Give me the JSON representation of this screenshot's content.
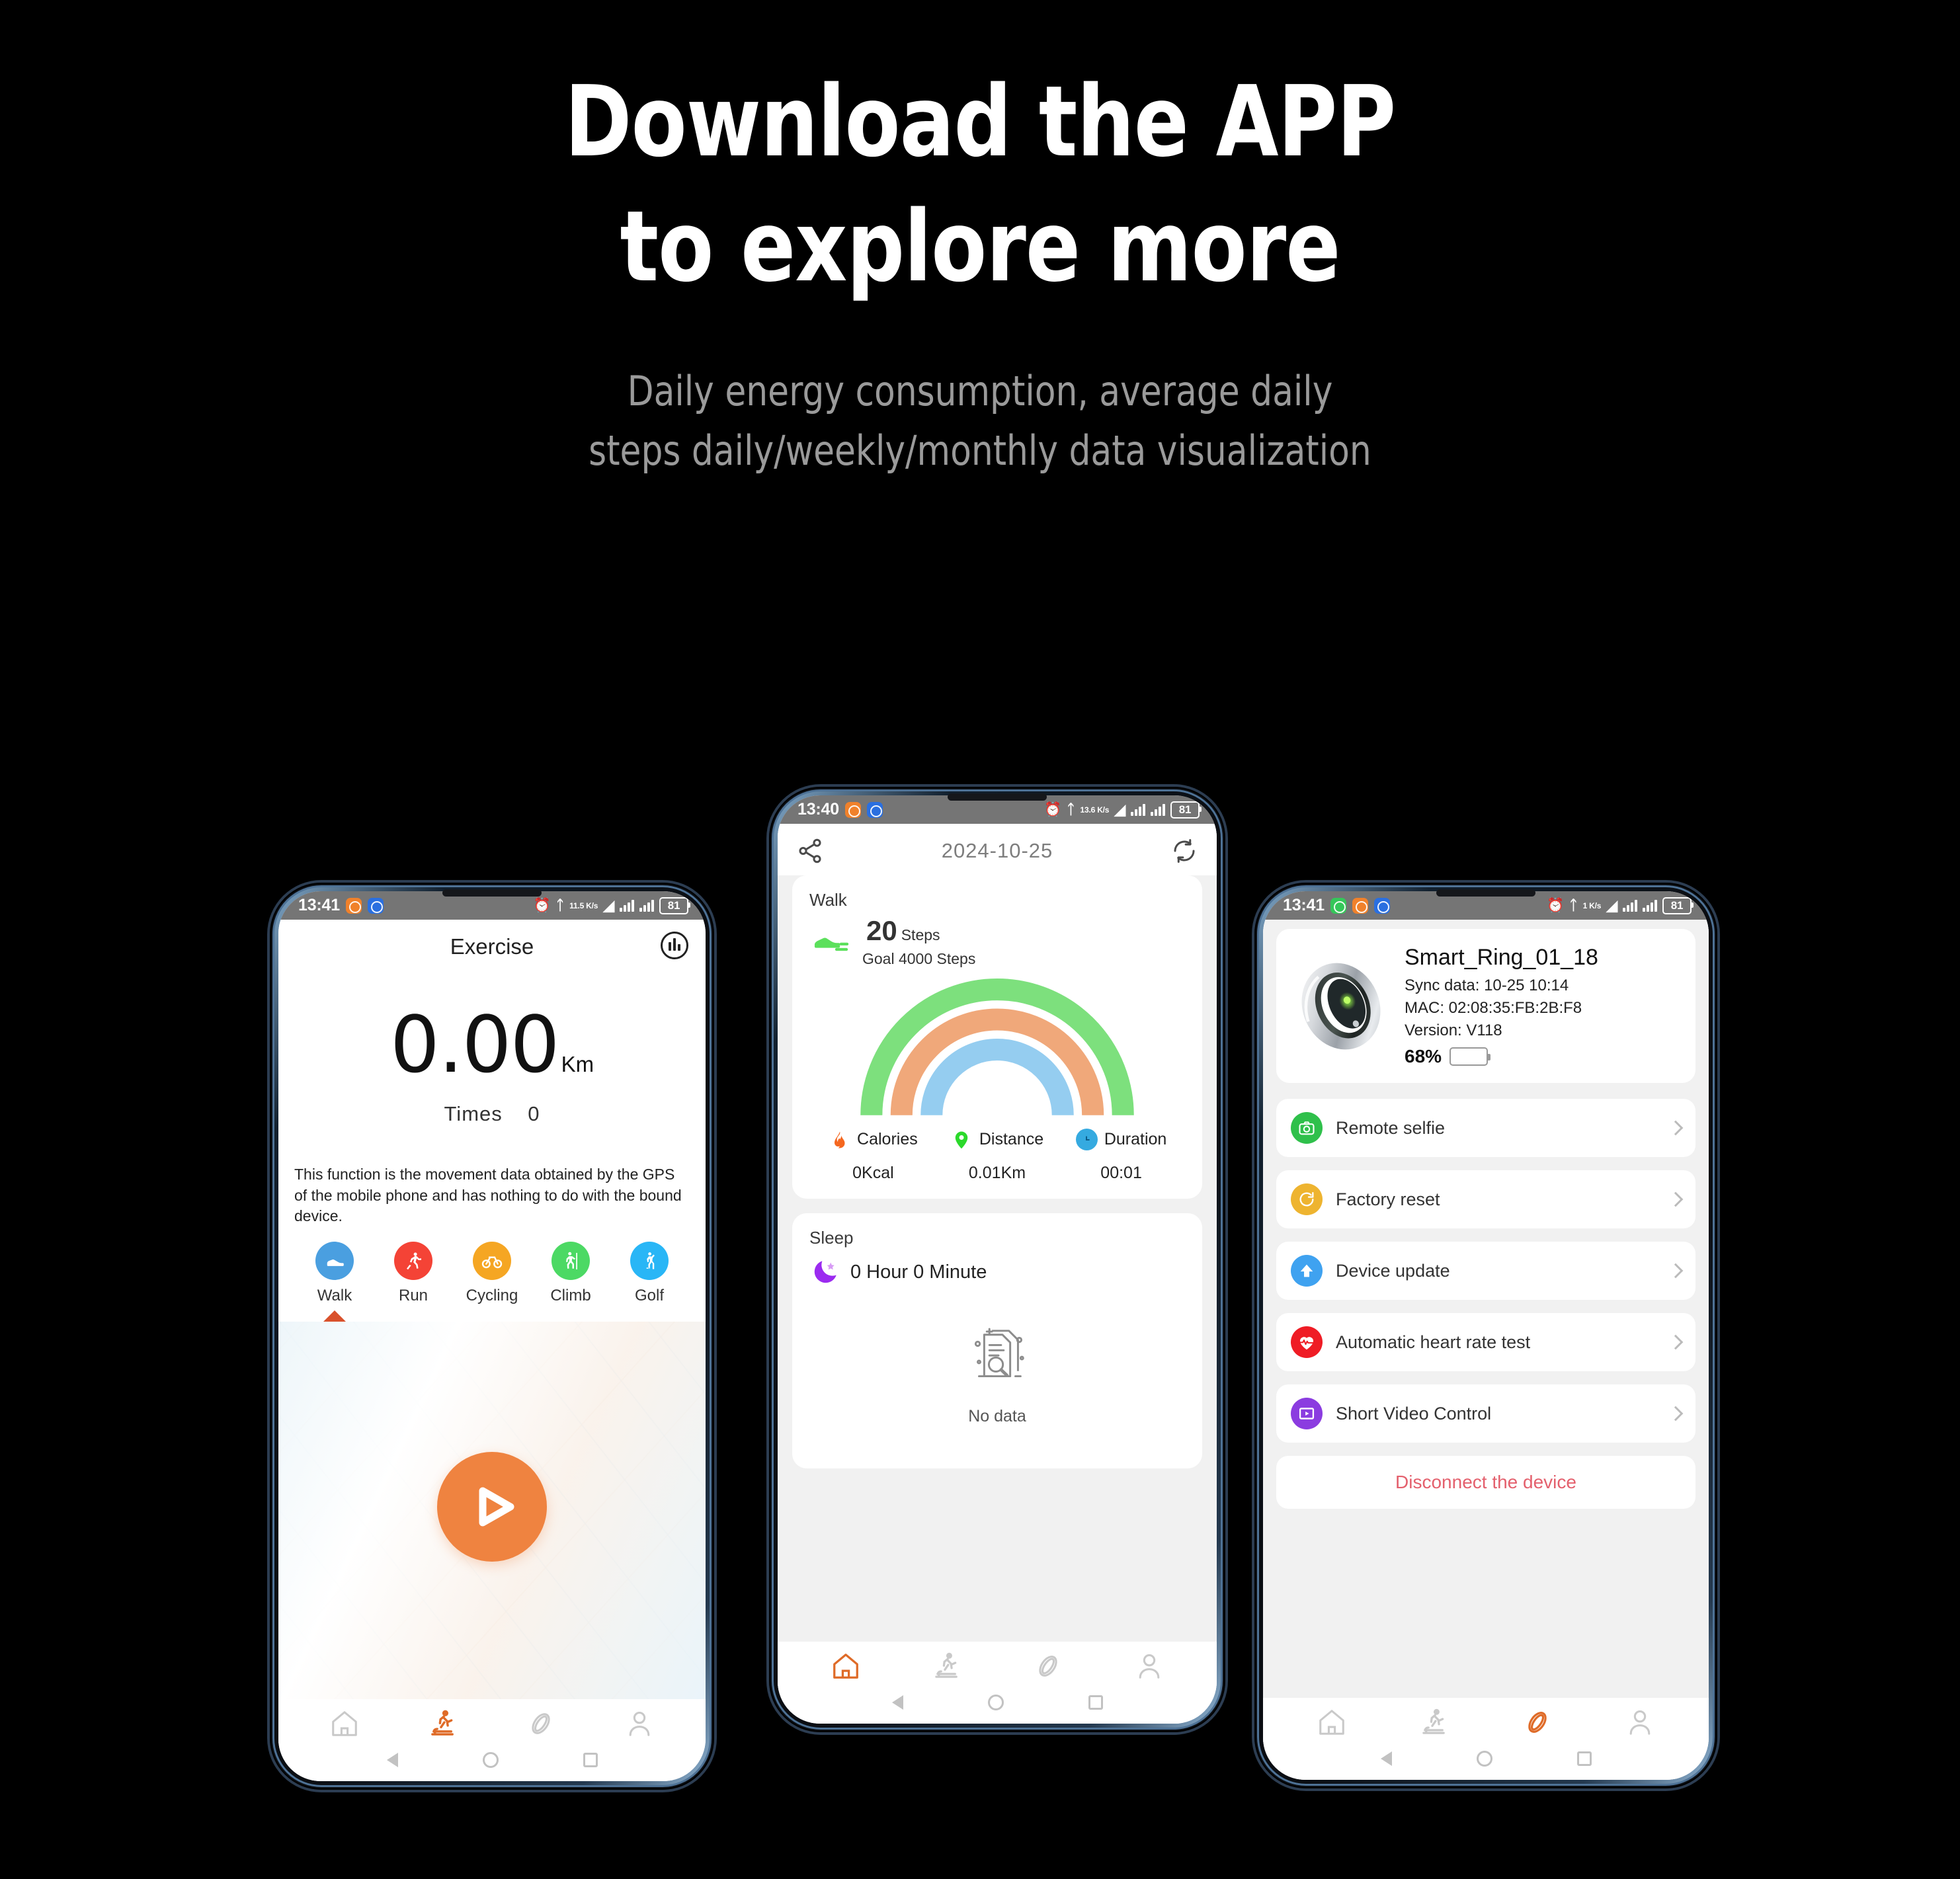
{
  "hero": {
    "title_line1": "Download the APP",
    "title_line2": "to explore more",
    "subtitle_line1": "Daily energy consumption, average daily",
    "subtitle_line2": "steps daily/weekly/monthly data visualization"
  },
  "colors": {
    "accent_orange": "#ef8340",
    "walk_blue": "#4a9fe0",
    "run_red": "#f44336",
    "cycling_orange": "#f5a623",
    "climb_green": "#4cd964",
    "golf_cyan": "#29b6f6",
    "gauge_green": "#7de07d",
    "gauge_orange": "#f0a87a",
    "gauge_blue": "#95cdf0",
    "disconnect_red": "#e4606d"
  },
  "phone_left": {
    "status": {
      "time": "13:41",
      "data_rate": "11.5 K/s",
      "battery": "81",
      "app_badges": [
        "orange",
        "blue"
      ]
    },
    "header": {
      "title": "Exercise",
      "chart_icon": "bar-chart-icon"
    },
    "distance": {
      "value": "0.00",
      "unit": "Km"
    },
    "times": {
      "label": "Times",
      "value": "0"
    },
    "note": "This function is the movement data obtained by the GPS of the mobile phone and has nothing to do with the bound device.",
    "sports": [
      {
        "label": "Walk",
        "icon": "shoe-icon",
        "color": "#4a9fe0",
        "selected": true
      },
      {
        "label": "Run",
        "icon": "runner-icon",
        "color": "#f44336",
        "selected": false
      },
      {
        "label": "Cycling",
        "icon": "bicycle-icon",
        "color": "#f5a623",
        "selected": false
      },
      {
        "label": "Climb",
        "icon": "hiker-icon",
        "color": "#4cd964",
        "selected": false
      },
      {
        "label": "Golf",
        "icon": "golfer-icon",
        "color": "#29b6f6",
        "selected": false
      }
    ],
    "play_button": "play-icon",
    "bottom_nav": [
      {
        "icon": "home-icon",
        "active": false
      },
      {
        "icon": "treadmill-icon",
        "active": true
      },
      {
        "icon": "ring-icon",
        "active": false
      },
      {
        "icon": "person-icon",
        "active": false
      }
    ]
  },
  "phone_middle": {
    "status": {
      "time": "13:40",
      "data_rate": "13.6 K/s",
      "battery": "81",
      "app_badges": [
        "orange",
        "blue"
      ]
    },
    "toolbar": {
      "share_icon": "share-icon",
      "date": "2024-10-25",
      "refresh_icon": "refresh-icon"
    },
    "walk_card": {
      "title": "Walk",
      "steps_value": "20",
      "steps_unit": "Steps",
      "goal": "Goal 4000 Steps",
      "metrics": [
        {
          "label": "Calories",
          "value": "0Kcal",
          "icon": "flame-icon",
          "color": "#f5671f"
        },
        {
          "label": "Distance",
          "value": "0.01Km",
          "icon": "location-pin-icon",
          "color": "#2bd92b"
        },
        {
          "label": "Duration",
          "value": "00:01",
          "icon": "clock-icon",
          "color": "#35aae0"
        }
      ]
    },
    "sleep_card": {
      "title": "Sleep",
      "duration": "0 Hour 0 Minute",
      "empty_label": "No data",
      "empty_icon": "no-data-document-icon"
    },
    "bottom_nav": [
      {
        "icon": "home-icon",
        "active": true
      },
      {
        "icon": "treadmill-icon",
        "active": false
      },
      {
        "icon": "ring-icon",
        "active": false
      },
      {
        "icon": "person-icon",
        "active": false
      }
    ]
  },
  "phone_right": {
    "status": {
      "time": "13:41",
      "data_rate": "1 K/s",
      "battery": "81",
      "app_badges": [
        "green",
        "orange",
        "blue"
      ]
    },
    "device": {
      "image_icon": "smart-ring-image",
      "name": "Smart_Ring_01_18",
      "sync": "Sync data: 10-25 10:14",
      "mac": "MAC: 02:08:35:FB:2B:F8",
      "version": "Version: V118",
      "battery_percent": "68%",
      "battery_level": 68
    },
    "settings": [
      {
        "label": "Remote selfie",
        "icon": "camera-icon",
        "color": "#2fc04b"
      },
      {
        "label": "Factory reset",
        "icon": "reset-icon",
        "color": "#eeb430"
      },
      {
        "label": "Device update",
        "icon": "upload-arrow-icon",
        "color": "#3fa2f0"
      },
      {
        "label": "Automatic heart rate test",
        "icon": "heartbeat-icon",
        "color": "#ef1c25"
      },
      {
        "label": "Short Video Control",
        "icon": "video-player-icon",
        "color": "#8b3ce0"
      }
    ],
    "disconnect": {
      "label": "Disconnect the device"
    },
    "bottom_nav": [
      {
        "icon": "home-icon",
        "active": false
      },
      {
        "icon": "treadmill-icon",
        "active": false
      },
      {
        "icon": "ring-icon",
        "active": true
      },
      {
        "icon": "person-icon",
        "active": false
      }
    ]
  }
}
